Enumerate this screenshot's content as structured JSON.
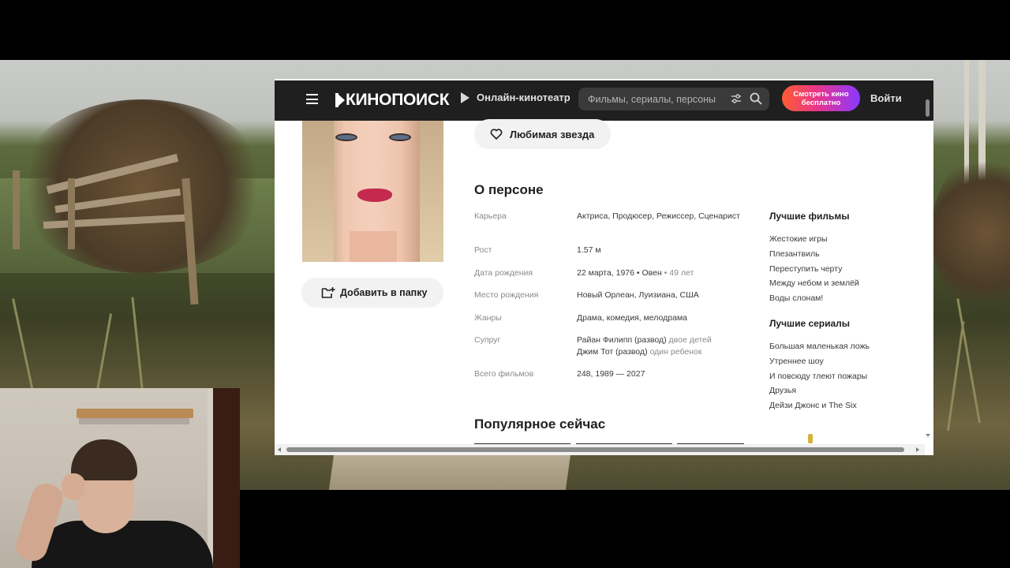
{
  "header": {
    "logo_text": "КИНОПОИСК",
    "online_label": "Онлайн-кинотеатр",
    "search_placeholder": "Фильмы, сериалы, персоны",
    "watch_label_line1": "Смотреть кино",
    "watch_label_line2": "бесплатно",
    "login_label": "Войти",
    "colors": {
      "header_bg": "#1f1f1f",
      "gradient_start": "#ff5c32",
      "gradient_mid": "#e8358c",
      "gradient_end": "#8a38ff"
    }
  },
  "actions": {
    "favorite_label": "Любимая звезда",
    "add_folder_label": "Добавить в папку"
  },
  "about": {
    "title": "О персоне",
    "facts": [
      {
        "key": "Карьера",
        "value": "Актриса, Продюсер, Режиссер, Сценарист"
      },
      {
        "key": "Рост",
        "value": "1.57 м"
      },
      {
        "key": "Дата рождения",
        "value_main": "22 марта, 1976 • Овен",
        "value_dim": " • 49 лет"
      },
      {
        "key": "Место рождения",
        "value": "Новый Орлеан, Луизиана, США"
      },
      {
        "key": "Жанры",
        "value": "Драма, комедия, мелодрама"
      },
      {
        "key": "Супруг",
        "spouse1": "Райан Филипп (развод)",
        "spouse1_note": "двое детей",
        "spouse2": "Джим Тот (развод)",
        "spouse2_note": "один ребенок"
      },
      {
        "key": "Всего фильмов",
        "value": "248, 1989 — 2027"
      }
    ]
  },
  "best_films": {
    "title": "Лучшие фильмы",
    "items": [
      "Жестокие игры",
      "Плезантвиль",
      "Переступить черту",
      "Между небом и землёй",
      "Воды слонам!"
    ]
  },
  "best_series": {
    "title": "Лучшие сериалы",
    "items": [
      "Большая маленькая ложь",
      "Утреннее шоу",
      "И повсюду тлеют пожары",
      "Друзья",
      "Дейзи Джонс и The Six"
    ]
  },
  "popular": {
    "title": "Популярное сейчас"
  },
  "icons": {
    "menu": "hamburger-icon",
    "play": "play-icon",
    "filter": "filter-sliders-icon",
    "search": "search-icon",
    "heart": "heart-icon",
    "folder_add": "folder-add-icon"
  }
}
